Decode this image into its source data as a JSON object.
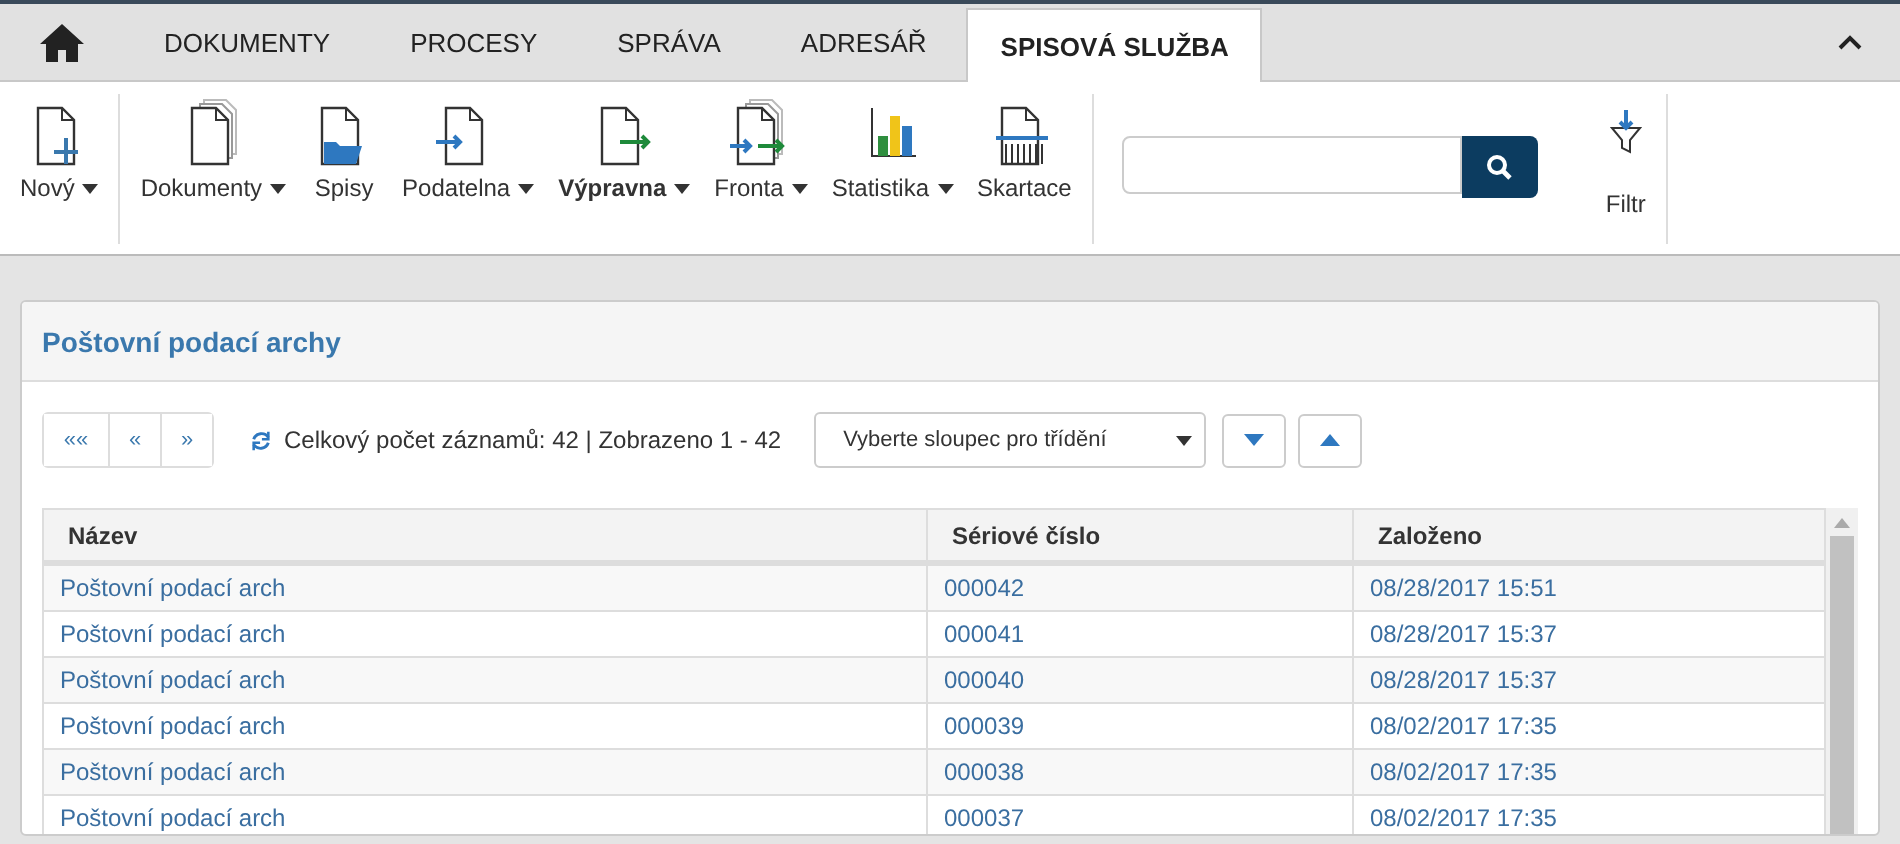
{
  "nav": {
    "tabs": [
      {
        "label": "DOKUMENTY",
        "selected": false
      },
      {
        "label": "PROCESY",
        "selected": false
      },
      {
        "label": "SPRÁVA",
        "selected": false
      },
      {
        "label": "ADRESÁŘ",
        "selected": false
      },
      {
        "label": "SPISOVÁ SLUŽBA",
        "selected": true
      }
    ]
  },
  "ribbon": {
    "items": [
      {
        "label": "Nový",
        "dropdown": true,
        "selected": false
      },
      {
        "label": "Dokumenty",
        "dropdown": true,
        "selected": false
      },
      {
        "label": "Spisy",
        "dropdown": false,
        "selected": false
      },
      {
        "label": "Podatelna",
        "dropdown": true,
        "selected": false
      },
      {
        "label": "Výpravna",
        "dropdown": true,
        "selected": true
      },
      {
        "label": "Fronta",
        "dropdown": true,
        "selected": false
      },
      {
        "label": "Statistika",
        "dropdown": true,
        "selected": false
      },
      {
        "label": "Skartace",
        "dropdown": false,
        "selected": false
      }
    ],
    "filter_label": "Filtr"
  },
  "panel": {
    "title": "Poštovní podací archy",
    "pager": [
      "««",
      "«",
      "»"
    ],
    "summary": "Celkový počet záznamů: 42 | Zobrazeno 1 - 42",
    "sort_select": {
      "placeholder": "Vyberte sloupec pro třídění"
    },
    "table": {
      "columns": [
        "Název",
        "Sériové číslo",
        "Založeno"
      ],
      "rows": [
        [
          "Poštovní podací arch",
          "000042",
          "08/28/2017 15:51"
        ],
        [
          "Poštovní podací arch",
          "000041",
          "08/28/2017 15:37"
        ],
        [
          "Poštovní podací arch",
          "000040",
          "08/28/2017 15:37"
        ],
        [
          "Poštovní podací arch",
          "000039",
          "08/02/2017 17:35"
        ],
        [
          "Poštovní podací arch",
          "000038",
          "08/02/2017 17:35"
        ],
        [
          "Poštovní podací arch",
          "000037",
          "08/02/2017 17:35"
        ]
      ]
    }
  }
}
